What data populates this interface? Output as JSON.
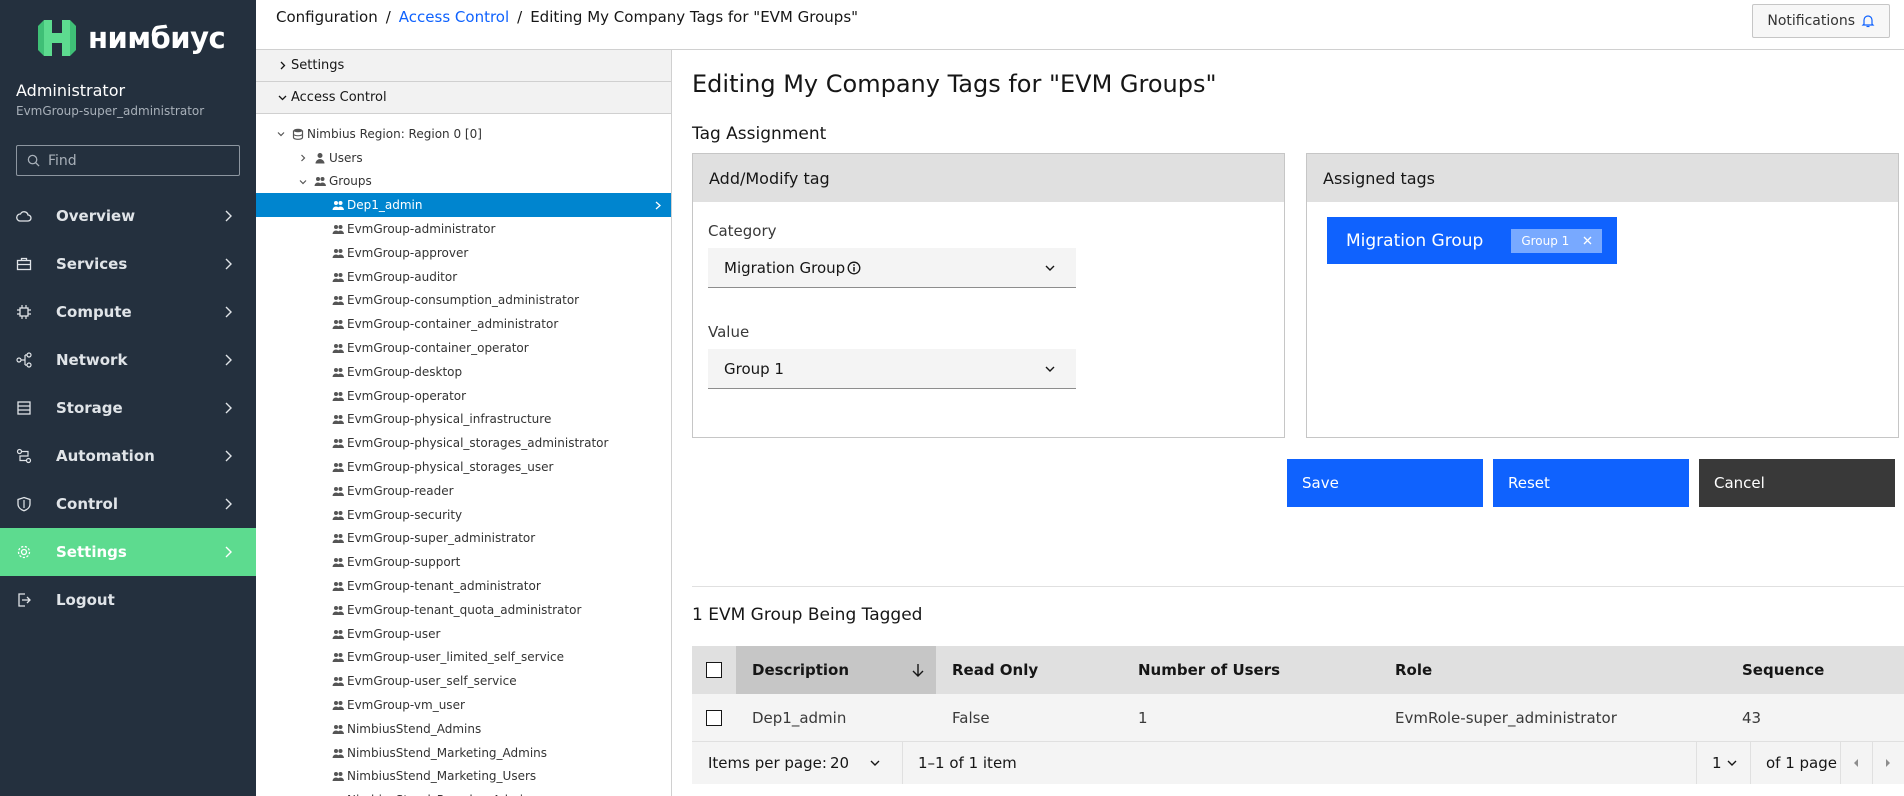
{
  "brand": {
    "name": "нимбиус"
  },
  "user": {
    "name": "Administrator",
    "role": "EvmGroup-super_administrator"
  },
  "search": {
    "placeholder": "Find"
  },
  "nav": [
    {
      "label": "Overview",
      "icon": "cloud-icon"
    },
    {
      "label": "Services",
      "icon": "briefcase-icon"
    },
    {
      "label": "Compute",
      "icon": "chip-icon"
    },
    {
      "label": "Network",
      "icon": "network-icon"
    },
    {
      "label": "Storage",
      "icon": "storage-icon"
    },
    {
      "label": "Automation",
      "icon": "automation-icon"
    },
    {
      "label": "Control",
      "icon": "shield-icon"
    },
    {
      "label": "Settings",
      "icon": "gear-icon",
      "active": true
    },
    {
      "label": "Logout",
      "icon": "logout-icon"
    }
  ],
  "breadcrumb": {
    "root": "Configuration",
    "link": "Access Control",
    "current": "Editing My Company Tags for \"EVM Groups\""
  },
  "header": {
    "notifications": "Notifications"
  },
  "accordion": {
    "settings": "Settings",
    "access_control": "Access Control"
  },
  "tree": {
    "region": "Nimbius Region: Region 0 [0]",
    "users": "Users",
    "groups": "Groups",
    "group_items": [
      "Dep1_admin",
      "EvmGroup-administrator",
      "EvmGroup-approver",
      "EvmGroup-auditor",
      "EvmGroup-consumption_administrator",
      "EvmGroup-container_administrator",
      "EvmGroup-container_operator",
      "EvmGroup-desktop",
      "EvmGroup-operator",
      "EvmGroup-physical_infrastructure",
      "EvmGroup-physical_storages_administrator",
      "EvmGroup-physical_storages_user",
      "EvmGroup-reader",
      "EvmGroup-security",
      "EvmGroup-super_administrator",
      "EvmGroup-support",
      "EvmGroup-tenant_administrator",
      "EvmGroup-tenant_quota_administrator",
      "EvmGroup-user",
      "EvmGroup-user_limited_self_service",
      "EvmGroup-user_self_service",
      "EvmGroup-vm_user",
      "NimbiusStend_Admins",
      "NimbiusStend_Marketing_Admins",
      "NimbiusStend_Marketing_Users",
      "NimbiusStend_Presales_Admins"
    ]
  },
  "main": {
    "title": "Editing My Company Tags for \"EVM Groups\"",
    "tag_assignment": "Tag Assignment",
    "add_modify": "Add/Modify tag",
    "assigned_tags": "Assigned tags",
    "category_label": "Category",
    "category_value": "Migration Group",
    "value_label": "Value",
    "value_value": "Group 1",
    "chip_category": "Migration Group",
    "chip_value": "Group 1",
    "save": "Save",
    "reset": "Reset",
    "cancel": "Cancel",
    "tagged_title": "1 EVM Group Being Tagged"
  },
  "table": {
    "headers": [
      "Description",
      "Read Only",
      "Number of Users",
      "Role",
      "Sequence"
    ],
    "rows": [
      [
        "Dep1_admin",
        "False",
        "1",
        "EvmRole-super_administrator",
        "43"
      ]
    ]
  },
  "pagination": {
    "items_per_page_label": "Items per page:",
    "items_per_page": "20",
    "range": "1–1 of 1 item",
    "page": "1",
    "of_pages": "of 1 page"
  },
  "colors": {
    "sidebar": "#24303e",
    "active_nav": "#5ddb8f",
    "primary": "#0f62fe",
    "tree_selected": "#0085cf"
  }
}
